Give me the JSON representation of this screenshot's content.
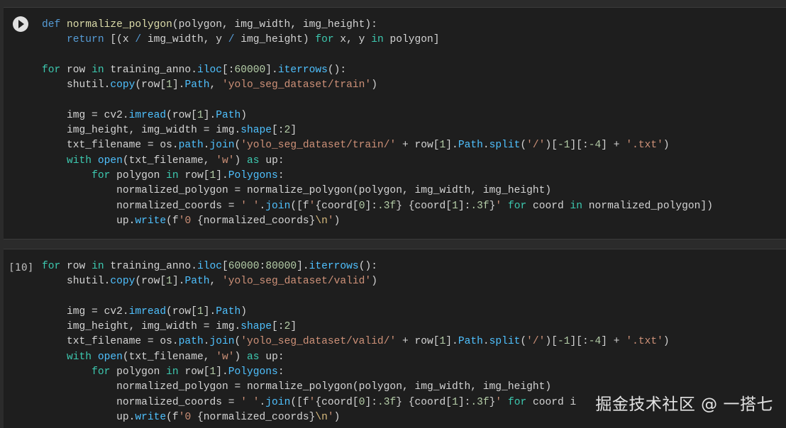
{
  "cells": [
    {
      "execution_count": "",
      "run_button_icon": "play-icon",
      "lines": [
        [
          [
            "kw",
            "def "
          ],
          [
            "fn",
            "normalize_polygon"
          ],
          [
            "pl",
            "(polygon, img_width, img_height):"
          ]
        ],
        [
          [
            "pl",
            "    "
          ],
          [
            "kw",
            "return "
          ],
          [
            "pl",
            "[(x "
          ],
          [
            "kw",
            "/ "
          ],
          [
            "pl",
            "img_width, y "
          ],
          [
            "kw",
            "/ "
          ],
          [
            "pl",
            "img_height) "
          ],
          [
            "ctl",
            "for "
          ],
          [
            "pl",
            "x, y "
          ],
          [
            "ctl",
            "in "
          ],
          [
            "pl",
            "polygon]"
          ]
        ],
        [
          [
            "pl",
            ""
          ]
        ],
        [
          [
            "ctl",
            "for "
          ],
          [
            "pl",
            "row "
          ],
          [
            "ctl",
            "in "
          ],
          [
            "pl",
            "training_anno."
          ],
          [
            "attr",
            "iloc"
          ],
          [
            "pl",
            "[:"
          ],
          [
            "num",
            "60000"
          ],
          [
            "pl",
            "]."
          ],
          [
            "attr",
            "iterrows"
          ],
          [
            "pl",
            "():"
          ]
        ],
        [
          [
            "pl",
            "    shutil."
          ],
          [
            "attr",
            "copy"
          ],
          [
            "pl",
            "(row["
          ],
          [
            "num",
            "1"
          ],
          [
            "pl",
            "]."
          ],
          [
            "attr",
            "Path"
          ],
          [
            "pl",
            ", "
          ],
          [
            "str",
            "'yolo_seg_dataset/train'"
          ],
          [
            "pl",
            ")"
          ]
        ],
        [
          [
            "pl",
            ""
          ]
        ],
        [
          [
            "pl",
            "    img = cv2."
          ],
          [
            "attr",
            "imread"
          ],
          [
            "pl",
            "(row["
          ],
          [
            "num",
            "1"
          ],
          [
            "pl",
            "]."
          ],
          [
            "attr",
            "Path"
          ],
          [
            "pl",
            ")"
          ]
        ],
        [
          [
            "pl",
            "    img_height, img_width = img."
          ],
          [
            "attr",
            "shape"
          ],
          [
            "pl",
            "[:"
          ],
          [
            "num",
            "2"
          ],
          [
            "pl",
            "]"
          ]
        ],
        [
          [
            "pl",
            "    txt_filename = os."
          ],
          [
            "attr",
            "path"
          ],
          [
            "pl",
            "."
          ],
          [
            "attr",
            "join"
          ],
          [
            "pl",
            "("
          ],
          [
            "str",
            "'yolo_seg_dataset/train/'"
          ],
          [
            "pl",
            " + row["
          ],
          [
            "num",
            "1"
          ],
          [
            "pl",
            "]."
          ],
          [
            "attr",
            "Path"
          ],
          [
            "pl",
            "."
          ],
          [
            "attr",
            "split"
          ],
          [
            "pl",
            "("
          ],
          [
            "str",
            "'/'"
          ],
          [
            "pl",
            ")["
          ],
          [
            "num",
            "-1"
          ],
          [
            "pl",
            "][:"
          ],
          [
            "num",
            "-4"
          ],
          [
            "pl",
            "] + "
          ],
          [
            "str",
            "'.txt'"
          ],
          [
            "pl",
            ")"
          ]
        ],
        [
          [
            "pl",
            "    "
          ],
          [
            "ctl",
            "with "
          ],
          [
            "bi",
            "open"
          ],
          [
            "pl",
            "(txt_filename, "
          ],
          [
            "str",
            "'w'"
          ],
          [
            "pl",
            ") "
          ],
          [
            "ctl",
            "as "
          ],
          [
            "pl",
            "up:"
          ]
        ],
        [
          [
            "pl",
            "        "
          ],
          [
            "ctl",
            "for "
          ],
          [
            "pl",
            "polygon "
          ],
          [
            "ctl",
            "in "
          ],
          [
            "pl",
            "row["
          ],
          [
            "num",
            "1"
          ],
          [
            "pl",
            "]."
          ],
          [
            "attr",
            "Polygons"
          ],
          [
            "pl",
            ":"
          ]
        ],
        [
          [
            "pl",
            "            normalized_polygon = normalize_polygon(polygon, img_width, img_height)"
          ]
        ],
        [
          [
            "pl",
            "            normalized_coords = "
          ],
          [
            "str",
            "' '"
          ],
          [
            "pl",
            "."
          ],
          [
            "attr",
            "join"
          ],
          [
            "pl",
            "([f"
          ],
          [
            "str",
            "'"
          ],
          [
            "pl",
            "{coord["
          ],
          [
            "num",
            "0"
          ],
          [
            "pl",
            "]:"
          ],
          [
            "num",
            ".3f"
          ],
          [
            "pl",
            "} {coord["
          ],
          [
            "num",
            "1"
          ],
          [
            "pl",
            "]:"
          ],
          [
            "num",
            ".3f"
          ],
          [
            "pl",
            "}"
          ],
          [
            "str",
            "'"
          ],
          [
            "pl",
            " "
          ],
          [
            "ctl",
            "for "
          ],
          [
            "pl",
            "coord "
          ],
          [
            "ctl",
            "in "
          ],
          [
            "pl",
            "normalized_polygon])"
          ]
        ],
        [
          [
            "pl",
            "            up."
          ],
          [
            "attr",
            "write"
          ],
          [
            "pl",
            "(f"
          ],
          [
            "str",
            "'0 "
          ],
          [
            "pl",
            "{normalized_coords}"
          ],
          [
            "esc",
            "\\n"
          ],
          [
            "str",
            "'"
          ],
          [
            "pl",
            ")"
          ]
        ]
      ]
    },
    {
      "execution_count": "[10]",
      "lines": [
        [
          [
            "ctl",
            "for "
          ],
          [
            "pl",
            "row "
          ],
          [
            "ctl",
            "in "
          ],
          [
            "pl",
            "training_anno."
          ],
          [
            "attr",
            "iloc"
          ],
          [
            "pl",
            "["
          ],
          [
            "num",
            "60000"
          ],
          [
            "pl",
            ":"
          ],
          [
            "num",
            "80000"
          ],
          [
            "pl",
            "]."
          ],
          [
            "attr",
            "iterrows"
          ],
          [
            "pl",
            "():"
          ]
        ],
        [
          [
            "pl",
            "    shutil."
          ],
          [
            "attr",
            "copy"
          ],
          [
            "pl",
            "(row["
          ],
          [
            "num",
            "1"
          ],
          [
            "pl",
            "]."
          ],
          [
            "attr",
            "Path"
          ],
          [
            "pl",
            ", "
          ],
          [
            "str",
            "'yolo_seg_dataset/valid'"
          ],
          [
            "pl",
            ")"
          ]
        ],
        [
          [
            "pl",
            ""
          ]
        ],
        [
          [
            "pl",
            "    img = cv2."
          ],
          [
            "attr",
            "imread"
          ],
          [
            "pl",
            "(row["
          ],
          [
            "num",
            "1"
          ],
          [
            "pl",
            "]."
          ],
          [
            "attr",
            "Path"
          ],
          [
            "pl",
            ")"
          ]
        ],
        [
          [
            "pl",
            "    img_height, img_width = img."
          ],
          [
            "attr",
            "shape"
          ],
          [
            "pl",
            "[:"
          ],
          [
            "num",
            "2"
          ],
          [
            "pl",
            "]"
          ]
        ],
        [
          [
            "pl",
            "    txt_filename = os."
          ],
          [
            "attr",
            "path"
          ],
          [
            "pl",
            "."
          ],
          [
            "attr",
            "join"
          ],
          [
            "pl",
            "("
          ],
          [
            "str",
            "'yolo_seg_dataset/valid/'"
          ],
          [
            "pl",
            " + row["
          ],
          [
            "num",
            "1"
          ],
          [
            "pl",
            "]."
          ],
          [
            "attr",
            "Path"
          ],
          [
            "pl",
            "."
          ],
          [
            "attr",
            "split"
          ],
          [
            "pl",
            "("
          ],
          [
            "str",
            "'/'"
          ],
          [
            "pl",
            ")["
          ],
          [
            "num",
            "-1"
          ],
          [
            "pl",
            "][:"
          ],
          [
            "num",
            "-4"
          ],
          [
            "pl",
            "] + "
          ],
          [
            "str",
            "'.txt'"
          ],
          [
            "pl",
            ")"
          ]
        ],
        [
          [
            "pl",
            "    "
          ],
          [
            "ctl",
            "with "
          ],
          [
            "bi",
            "open"
          ],
          [
            "pl",
            "(txt_filename, "
          ],
          [
            "str",
            "'w'"
          ],
          [
            "pl",
            ") "
          ],
          [
            "ctl",
            "as "
          ],
          [
            "pl",
            "up:"
          ]
        ],
        [
          [
            "pl",
            "        "
          ],
          [
            "ctl",
            "for "
          ],
          [
            "pl",
            "polygon "
          ],
          [
            "ctl",
            "in "
          ],
          [
            "pl",
            "row["
          ],
          [
            "num",
            "1"
          ],
          [
            "pl",
            "]."
          ],
          [
            "attr",
            "Polygons"
          ],
          [
            "pl",
            ":"
          ]
        ],
        [
          [
            "pl",
            "            normalized_polygon = normalize_polygon(polygon, img_width, img_height)"
          ]
        ],
        [
          [
            "pl",
            "            normalized_coords = "
          ],
          [
            "str",
            "' '"
          ],
          [
            "pl",
            "."
          ],
          [
            "attr",
            "join"
          ],
          [
            "pl",
            "([f"
          ],
          [
            "str",
            "'"
          ],
          [
            "pl",
            "{coord["
          ],
          [
            "num",
            "0"
          ],
          [
            "pl",
            "]:"
          ],
          [
            "num",
            ".3f"
          ],
          [
            "pl",
            "} {coord["
          ],
          [
            "num",
            "1"
          ],
          [
            "pl",
            "]:"
          ],
          [
            "num",
            ".3f"
          ],
          [
            "pl",
            "}"
          ],
          [
            "str",
            "'"
          ],
          [
            "pl",
            " "
          ],
          [
            "ctl",
            "for "
          ],
          [
            "pl",
            "coord i"
          ]
        ],
        [
          [
            "pl",
            "            up."
          ],
          [
            "attr",
            "write"
          ],
          [
            "pl",
            "(f"
          ],
          [
            "str",
            "'0 "
          ],
          [
            "pl",
            "{normalized_coords}"
          ],
          [
            "esc",
            "\\n"
          ],
          [
            "str",
            "'"
          ],
          [
            "pl",
            ")"
          ]
        ]
      ]
    }
  ],
  "watermark": "掘金技术社区 @ 一搭七"
}
